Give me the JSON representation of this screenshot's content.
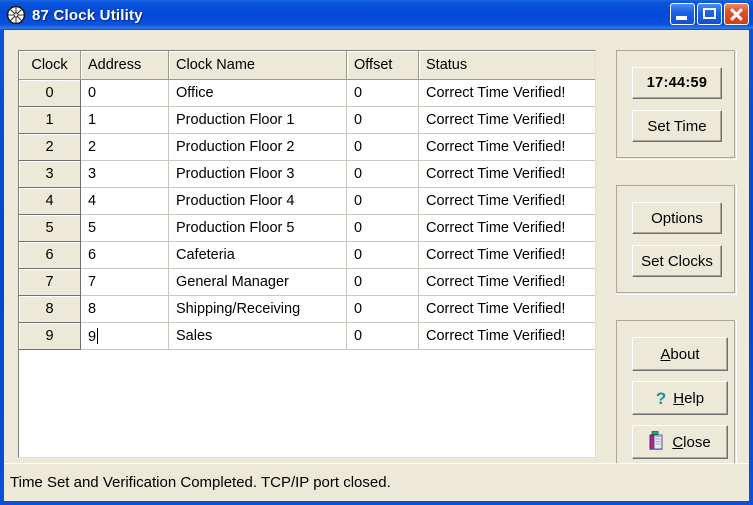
{
  "window": {
    "title": "87 Clock Utility",
    "icon": "clock-icon",
    "frame_color": "#0246d1",
    "client_color": "#ece9d8",
    "controls": [
      {
        "name": "minimize",
        "glyph": "minimize-icon"
      },
      {
        "name": "maximize",
        "glyph": "maximize-icon"
      },
      {
        "name": "close",
        "glyph": "close-icon"
      }
    ]
  },
  "grid": {
    "columns": [
      "Clock",
      "Address",
      "Clock Name",
      "Offset",
      "Status"
    ],
    "rows": [
      {
        "clock": "0",
        "address": "0",
        "name": "Office",
        "offset": "0",
        "status": "Correct Time Verified!",
        "editing": false
      },
      {
        "clock": "1",
        "address": "1",
        "name": "Production Floor 1",
        "offset": "0",
        "status": "Correct Time Verified!",
        "editing": false
      },
      {
        "clock": "2",
        "address": "2",
        "name": "Production Floor 2",
        "offset": "0",
        "status": "Correct Time Verified!",
        "editing": false
      },
      {
        "clock": "3",
        "address": "3",
        "name": "Production Floor 3",
        "offset": "0",
        "status": "Correct Time Verified!",
        "editing": false
      },
      {
        "clock": "4",
        "address": "4",
        "name": "Production Floor 4",
        "offset": "0",
        "status": "Correct Time Verified!",
        "editing": false
      },
      {
        "clock": "5",
        "address": "5",
        "name": "Production Floor 5",
        "offset": "0",
        "status": "Correct Time Verified!",
        "editing": false
      },
      {
        "clock": "6",
        "address": "6",
        "name": "Cafeteria",
        "offset": "0",
        "status": "Correct Time Verified!",
        "editing": false
      },
      {
        "clock": "7",
        "address": "7",
        "name": "General Manager",
        "offset": "0",
        "status": "Correct Time Verified!",
        "editing": false
      },
      {
        "clock": "8",
        "address": "8",
        "name": "Shipping/Receiving",
        "offset": "0",
        "status": "Correct Time Verified!",
        "editing": false
      },
      {
        "clock": "9",
        "address": "9",
        "name": "Sales",
        "offset": "0",
        "status": "Correct Time Verified!",
        "editing": true
      }
    ]
  },
  "panels": {
    "time": {
      "clock_readout": "17:44:59",
      "set_time_label": "Set Time"
    },
    "config": {
      "options_label": "Options",
      "set_clocks_label": "Set Clocks"
    },
    "misc": {
      "about_label": "About",
      "help_label": "Help",
      "help_icon": "question-mark-icon",
      "help_icon_color": "#0f9898",
      "close_label": "Close",
      "close_icon": "exit-door-icon"
    }
  },
  "statusbar": {
    "message": "Time Set and Verification Completed. TCP/IP port closed."
  }
}
